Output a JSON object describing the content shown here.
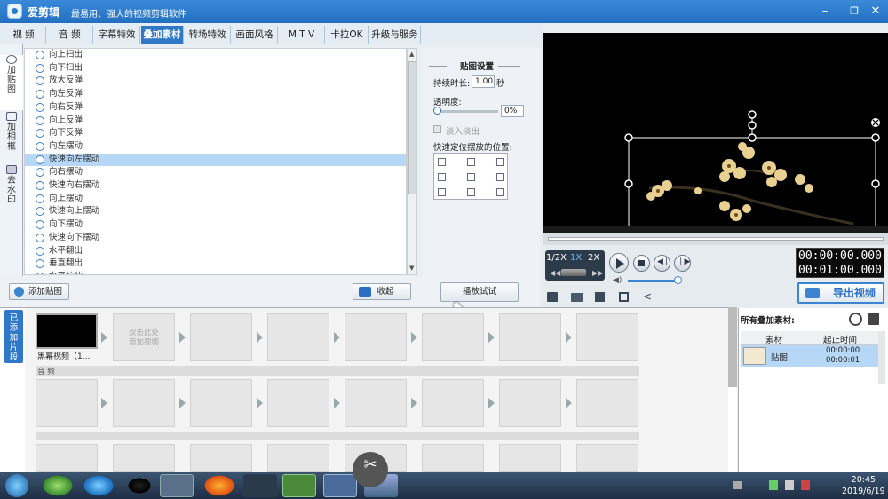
{
  "app": {
    "title": "爱剪辑",
    "slogan": "最易用、强大的视频剪辑软件"
  },
  "window_controls": {
    "minimize": "–",
    "restore": "❐",
    "close": "✕"
  },
  "tabs": [
    {
      "label": "视  频",
      "active": false
    },
    {
      "label": "音  频",
      "active": false
    },
    {
      "label": "字幕特效",
      "active": false
    },
    {
      "label": "叠加素材",
      "active": true
    },
    {
      "label": "转场特效",
      "active": false
    },
    {
      "label": "画面风格",
      "active": false
    },
    {
      "label": "M T V",
      "active": false
    },
    {
      "label": "卡拉OK",
      "active": false
    },
    {
      "label": "升级与服务",
      "active": false
    }
  ],
  "side_tabs": [
    "加贴图",
    "加相框",
    "去水印"
  ],
  "effects": [
    "向上扫出",
    "向下扫出",
    "放大反弹",
    "向左反弹",
    "向右反弹",
    "向上反弹",
    "向下反弹",
    "向左摆动",
    "快速向左摆动",
    "向右摆动",
    "快速向右摆动",
    "向上摆动",
    "快速向上摆动",
    "向下摆动",
    "快速向下摆动",
    "水平翻出",
    "垂直翻出",
    "水平拉伸"
  ],
  "selected_effect": "快速向左摆动",
  "list_buttons": {
    "add_sticker": "添加贴图",
    "collapse": "收起"
  },
  "settings": {
    "title": "贴图设置",
    "duration_label": "持续时长:",
    "duration_value": "1.00",
    "duration_unit": "秒",
    "opacity_label": "透明度:",
    "opacity_value": "0%",
    "fade_label": "淡入淡出",
    "position_label": "快速定位摆放的位置:",
    "play_test": "播放试试"
  },
  "player": {
    "speed_half": "1/2X",
    "speed_1x": "1X",
    "speed_2x": "2X",
    "current_time": "00:00:00.000",
    "total_time": "00:01:00.000",
    "export": "导出视频"
  },
  "timeline": {
    "tab_label": "已添加片段",
    "clip_name": "黑幕视频（1...",
    "add_hint_1": "双击此处",
    "add_hint_2": "添加视频",
    "audio_label": "音  频"
  },
  "overlay_panel": {
    "title": "所有叠加素材:",
    "col_material": "素材",
    "col_time": "起止时间",
    "item_name": "贴图",
    "item_start": "00:00:00",
    "item_end": "00:00:01"
  },
  "taskbar": {
    "time": "20:45",
    "date": "2019/6/19"
  }
}
